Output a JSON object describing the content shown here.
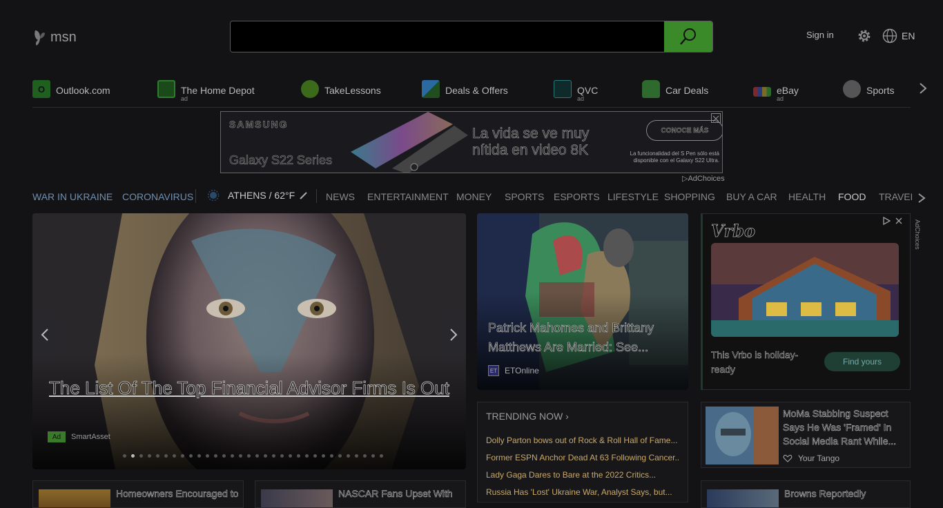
{
  "header": {
    "logo_text": "msn",
    "search_placeholder": "",
    "signin": "Sign in",
    "lang": "EN"
  },
  "quick_links": [
    {
      "label": "Outlook.com",
      "ad": "",
      "icon": "outlook-icon",
      "color": "#2b8a2b"
    },
    {
      "label": "The Home Depot",
      "ad": "ad",
      "icon": "home-depot-icon",
      "color": "#2e7d2e"
    },
    {
      "label": "TakeLessons",
      "ad": "",
      "icon": "takelessons-icon",
      "color": "#4a8a2a"
    },
    {
      "label": "Deals & Offers",
      "ad": "",
      "icon": "deals-icon",
      "color": "#2a6aa0"
    },
    {
      "label": "QVC",
      "ad": "ad",
      "icon": "qvc-icon",
      "color": "#2a7a7a"
    },
    {
      "label": "Car Deals",
      "ad": "",
      "icon": "car-icon",
      "color": "#3a8a3a"
    },
    {
      "label": "eBay",
      "ad": "ad",
      "icon": "ebay-icon",
      "color": "#7a6a2a"
    },
    {
      "label": "Sports",
      "ad": "",
      "icon": "sports-icon",
      "color": "#888888"
    }
  ],
  "banner_ad": {
    "brand": "SAMSUNG",
    "model": "Galaxy S22 Series",
    "headline": "La vida se ve muy nítida en video 8K",
    "cta": "CONOCE MÁS",
    "fine_print": "La funcionalidad del S Pen sólo está disponible con el Galaxy S22 Ultra.",
    "adchoices": "AdChoices"
  },
  "nav": {
    "items_left": [
      "WAR IN UKRAINE",
      "CORONAVIRUS"
    ],
    "weather": "ATHENS / 62°F",
    "items": [
      "NEWS",
      "ENTERTAINMENT",
      "MONEY",
      "SPORTS",
      "ESPORTS",
      "LIFESTYLE",
      "SHOPPING",
      "BUY A CAR",
      "HEALTH",
      "FOOD",
      "TRAVEL"
    ]
  },
  "hero": {
    "title": "The List Of The Top Financial Advisor Firms Is Out",
    "ad_badge": "Ad",
    "source": "SmartAsset",
    "slide_count": 32,
    "active_slide": 1
  },
  "card2": {
    "title": "Patrick Mahomes and Brittany Matthews Are Married: See...",
    "source_icon": "ET",
    "source": "ETOnline"
  },
  "vrbo": {
    "logo": "Vrbo",
    "text": "This Vrbo is holiday-ready",
    "button": "Find yours",
    "adchoices": "AdChoices"
  },
  "trending": {
    "header": "TRENDING NOW",
    "items": [
      "Dolly Parton bows out of Rock & Roll Hall of Fame...",
      "Former ESPN Anchor Dead At 63 Following Cancer...",
      "Lady Gaga Dares to Bare at the 2022 Critics...",
      "Russia Has 'Lost' Ukraine War, Analyst Says, but..."
    ]
  },
  "side1": {
    "title": "MoMa Stabbing Suspect Says He Was 'Framed' In Social Media Rant While...",
    "source": "Your Tango"
  },
  "bottom": [
    {
      "title": "Homeowners Encouraged to"
    },
    {
      "title": "NASCAR Fans Upset With"
    },
    {
      "title": "Browns Reportedly"
    }
  ]
}
